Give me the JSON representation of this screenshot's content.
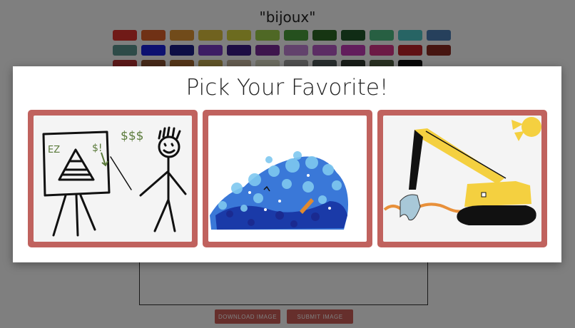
{
  "prompt": {
    "word": "\"bijoux\""
  },
  "palette": {
    "colors": [
      "#e0342f",
      "#e0622a",
      "#e29734",
      "#e0c43e",
      "#d8d63f",
      "#9ed04a",
      "#4aa03c",
      "#2d6a25",
      "#20582b",
      "#4fbf84",
      "#4fc8c8",
      "#4d80b8",
      "#5d9690",
      "#1a22e0",
      "#1a1c8a",
      "#7a3ac8",
      "#3a1a88",
      "#7a2a9a",
      "#c484d8",
      "#b85ac8",
      "#c43ab8",
      "#d8348a",
      "#c02228",
      "#8c2a20",
      "#b83232",
      "#8c5230",
      "#a86a30",
      "#c0a850",
      "#c8b8a0",
      "#d8d8c0",
      "#a0a0a0",
      "#505a5a",
      "#303a30",
      "#506040",
      "#101010",
      "#ffffff"
    ]
  },
  "buttons": {
    "download": "DOWNLOAD IMAGE",
    "submit": "SUBMIT IMAGE"
  },
  "modal": {
    "title": "Pick Your Favorite!",
    "options": [
      {
        "name": "stick figure presenting pyramid chart",
        "annotations": [
          "EZ",
          "$!",
          "$$$"
        ]
      },
      {
        "name": "blue ocean wave with surfer"
      },
      {
        "name": "yellow excavator crane"
      }
    ]
  }
}
